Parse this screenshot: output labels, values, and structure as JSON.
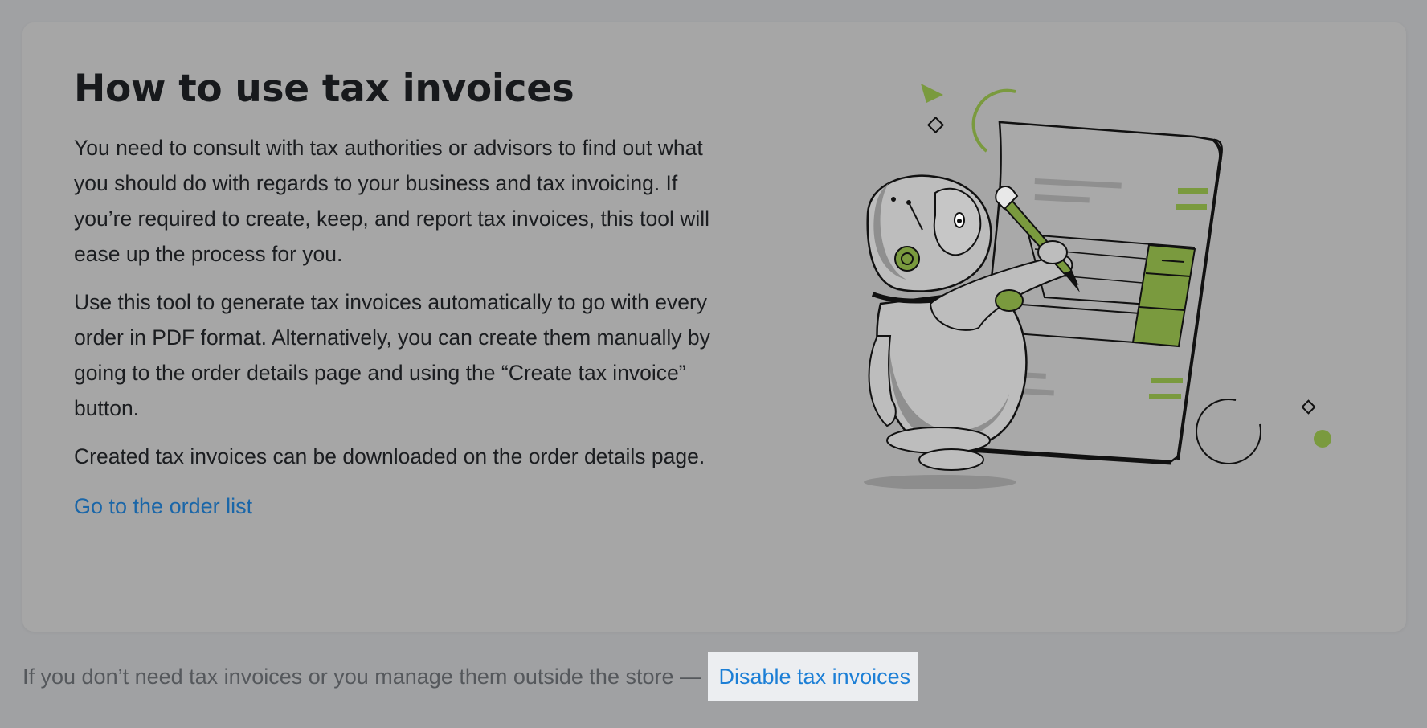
{
  "card": {
    "title": "How to use tax invoices",
    "paragraphs": [
      "You need to consult with tax authorities or advisors to find out what you should do with regards to your business and tax invoicing. If you’re required to create, keep, and report tax invoices, this tool will ease up the process for you.",
      "Use this tool to generate tax invoices automatically to go with every order in PDF format. Alternatively, you can create them manually by going to the order details page and using the “Create tax invoice” button.",
      "Created tax invoices can be downloaded on the order details page."
    ],
    "order_list_link": "Go to the order list",
    "illustration_icon": "robot-writing-invoice-illustration"
  },
  "footer": {
    "text": "If you don’t need tax invoices or you manage them outside the store — ",
    "disable_link": "Disable tax invoices"
  },
  "colors": {
    "page_background": "#a0a1a3",
    "card_background": "#a6a6a6",
    "accent_green": "#7a9a3e",
    "link_blue": "#1a66a8",
    "footer_link_blue": "#1c7fd6",
    "footer_link_bg": "#eceef1"
  }
}
